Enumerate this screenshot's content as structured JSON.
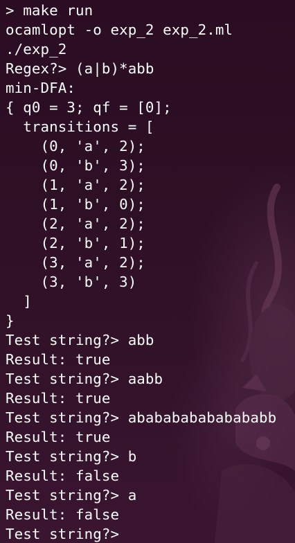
{
  "terminal": {
    "lines": [
      "> make run",
      "ocamlopt -o exp_2 exp_2.ml",
      "./exp_2",
      "Regex?> (a|b)*abb",
      "min-DFA:",
      "{ q0 = 3; qf = [0];",
      "  transitions = [",
      "    (0, 'a', 2);",
      "    (0, 'b', 3);",
      "    (1, 'a', 2);",
      "    (1, 'b', 0);",
      "    (2, 'a', 2);",
      "    (2, 'b', 1);",
      "    (3, 'a', 2);",
      "    (3, 'b', 3)",
      "  ]",
      "}",
      "Test string?> abb",
      "Result: true",
      "Test string?> aabb",
      "Result: true",
      "Test string?> ababababababababb",
      "Result: true",
      "Test string?> b",
      "Result: false",
      "Test string?> a",
      "Result: false",
      "Test string?> "
    ]
  },
  "colors": {
    "background": "#2b0f24",
    "foreground": "#ffffff"
  }
}
